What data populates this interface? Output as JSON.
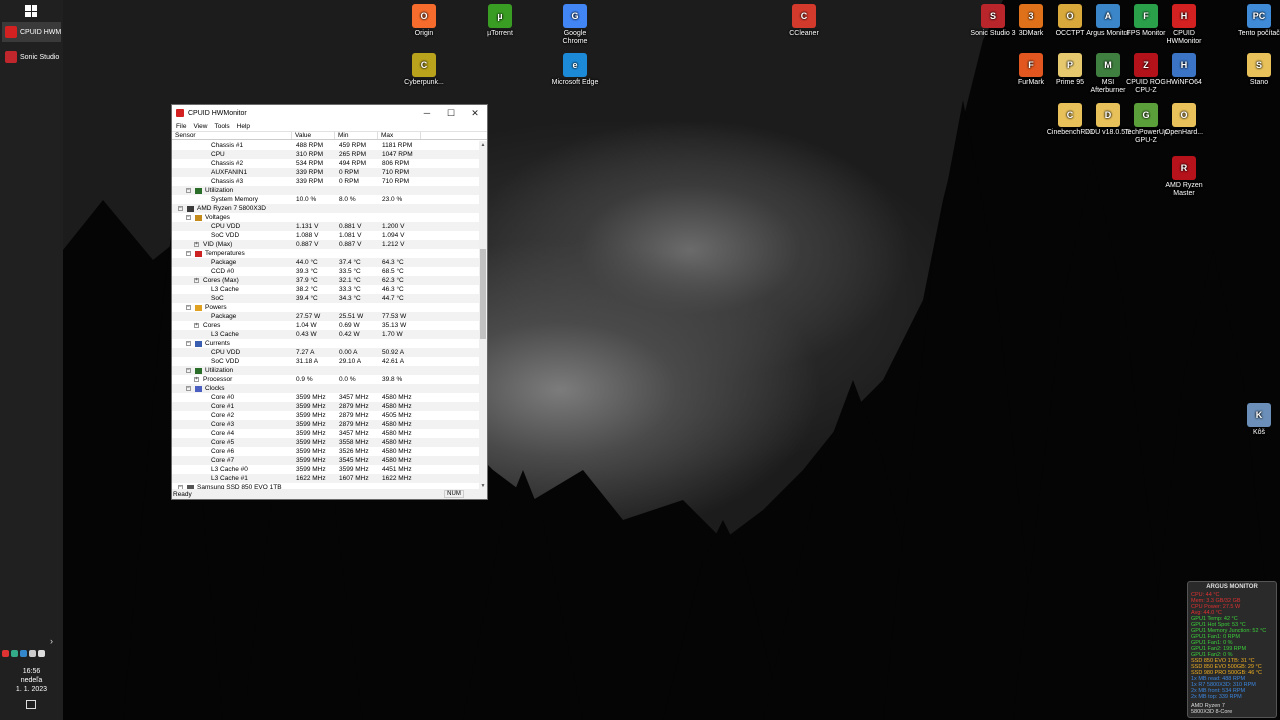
{
  "taskbar": {
    "apps": [
      {
        "label": "CPUID HWM...",
        "active": true,
        "icon": "hwmonitor-icon",
        "color": "#d32020"
      },
      {
        "label": "Sonic Studio 3",
        "active": false,
        "icon": "sonic-studio-icon",
        "color": "#c0272d"
      }
    ],
    "clock": {
      "time": "16:56",
      "day": "nedeľa",
      "date": "1. 1. 2023"
    }
  },
  "desktop_icons": [
    {
      "label": "Origin",
      "color": "#f56c2d",
      "glyph": "O"
    },
    {
      "label": "µTorrent",
      "color": "#3a9d23",
      "glyph": "µ"
    },
    {
      "label": "Google Chrome",
      "color": "#4285f4",
      "glyph": "G"
    },
    {
      "label": "CCleaner",
      "color": "#d33a2c",
      "glyph": "C"
    },
    {
      "label": "Cyberpunk...",
      "color": "#b9a21c",
      "glyph": "C"
    },
    {
      "label": "Microsoft Edge",
      "color": "#1c8ad6",
      "glyph": "e"
    },
    {
      "label": "Sonic Studio 3",
      "color": "#b8262b",
      "glyph": "S"
    },
    {
      "label": "3DMark",
      "color": "#e0711b",
      "glyph": "3"
    },
    {
      "label": "OCCTPT",
      "color": "#d9a93c",
      "glyph": "O"
    },
    {
      "label": "Argus Monitor",
      "color": "#3b86c9",
      "glyph": "A"
    },
    {
      "label": "FPS Monitor",
      "color": "#2aa04a",
      "glyph": "F"
    },
    {
      "label": "CPUID HWMonitor",
      "color": "#d32020",
      "glyph": "H"
    },
    {
      "label": "Tento počítač",
      "color": "#3f8bd8",
      "glyph": "PC"
    },
    {
      "label": "FurMark",
      "color": "#e2571f",
      "glyph": "F"
    },
    {
      "label": "Prime 95",
      "color": "#e6c86e",
      "glyph": "P"
    },
    {
      "label": "MSI Afterburner",
      "color": "#3f7f3f",
      "glyph": "M"
    },
    {
      "label": "CPUID ROG CPU-Z",
      "color": "#b3121b",
      "glyph": "Z"
    },
    {
      "label": "HWiNFO64",
      "color": "#3b74c4",
      "glyph": "H"
    },
    {
      "label": "Stano",
      "color": "#e8c15a",
      "glyph": "S"
    },
    {
      "label": "CinebenchR23",
      "color": "#e8c15a",
      "glyph": "C"
    },
    {
      "label": "DDU v18.0.5.9",
      "color": "#e8c15a",
      "glyph": "D"
    },
    {
      "label": "TechPowerUp GPU-Z",
      "color": "#5b9f3a",
      "glyph": "G"
    },
    {
      "label": "OpenHard...",
      "color": "#e8c15a",
      "glyph": "O"
    },
    {
      "label": "AMD Ryzen Master",
      "color": "#b5121b",
      "glyph": "R"
    },
    {
      "label": "Kôš",
      "color": "#6b8fb8",
      "glyph": "K"
    }
  ],
  "hwmonitor": {
    "title": "CPUID HWMonitor",
    "menu": [
      "File",
      "View",
      "Tools",
      "Help"
    ],
    "columns": [
      "Sensor",
      "Value",
      "Min",
      "Max"
    ],
    "rows": [
      {
        "indent": 4,
        "label": "Chassis #1",
        "value": "488 RPM",
        "min": "459 RPM",
        "max": "1181 RPM"
      },
      {
        "indent": 4,
        "label": "CPU",
        "value": "310 RPM",
        "min": "265 RPM",
        "max": "1047 RPM"
      },
      {
        "indent": 4,
        "label": "Chassis #2",
        "value": "534 RPM",
        "min": "494 RPM",
        "max": "806 RPM"
      },
      {
        "indent": 4,
        "label": "AUXFANIN1",
        "value": "339 RPM",
        "min": "0 RPM",
        "max": "710 RPM"
      },
      {
        "indent": 4,
        "label": "Chassis #3",
        "value": "339 RPM",
        "min": "0 RPM",
        "max": "710 RPM"
      },
      {
        "indent": 2,
        "label": "Utilization",
        "group": true,
        "gicon": "#2a6e2a",
        "value": "",
        "min": "",
        "max": ""
      },
      {
        "indent": 4,
        "label": "System Memory",
        "value": "10.0 %",
        "min": "8.0 %",
        "max": "23.0 %"
      },
      {
        "indent": 1,
        "label": "AMD Ryzen 7 5800X3D",
        "group": true,
        "gicon": "#3b3b3b",
        "value": "",
        "min": "",
        "max": ""
      },
      {
        "indent": 2,
        "label": "Voltages",
        "group": true,
        "gicon": "#c48a1a",
        "value": "",
        "min": "",
        "max": ""
      },
      {
        "indent": 4,
        "label": "CPU VDD",
        "value": "1.131 V",
        "min": "0.881 V",
        "max": "1.200 V"
      },
      {
        "indent": 4,
        "label": "SoC VDD",
        "value": "1.088 V",
        "min": "1.081 V",
        "max": "1.094 V"
      },
      {
        "indent": 3,
        "label": "VID (Max)",
        "expand": true,
        "value": "0.887 V",
        "min": "0.887 V",
        "max": "1.212 V"
      },
      {
        "indent": 2,
        "label": "Temperatures",
        "group": true,
        "gicon": "#cc2222",
        "value": "",
        "min": "",
        "max": ""
      },
      {
        "indent": 4,
        "label": "Package",
        "value": "44.0 °C",
        "min": "37.4 °C",
        "max": "64.3 °C"
      },
      {
        "indent": 4,
        "label": "CCD #0",
        "value": "39.3 °C",
        "min": "33.5 °C",
        "max": "68.5 °C"
      },
      {
        "indent": 3,
        "label": "Cores (Max)",
        "expand": true,
        "value": "37.9 °C",
        "min": "32.1 °C",
        "max": "62.3 °C"
      },
      {
        "indent": 4,
        "label": "L3 Cache",
        "value": "38.2 °C",
        "min": "33.3 °C",
        "max": "46.3 °C"
      },
      {
        "indent": 4,
        "label": "SoC",
        "value": "39.4 °C",
        "min": "34.3 °C",
        "max": "44.7 °C"
      },
      {
        "indent": 2,
        "label": "Powers",
        "group": true,
        "gicon": "#e0a020",
        "value": "",
        "min": "",
        "max": ""
      },
      {
        "indent": 4,
        "label": "Package",
        "value": "27.57 W",
        "min": "25.51 W",
        "max": "77.53 W"
      },
      {
        "indent": 3,
        "label": "Cores",
        "expand": true,
        "value": "1.04 W",
        "min": "0.69 W",
        "max": "35.13 W"
      },
      {
        "indent": 4,
        "label": "L3 Cache",
        "value": "0.43 W",
        "min": "0.42 W",
        "max": "1.70 W"
      },
      {
        "indent": 2,
        "label": "Currents",
        "group": true,
        "gicon": "#3a5fb0",
        "value": "",
        "min": "",
        "max": ""
      },
      {
        "indent": 4,
        "label": "CPU VDD",
        "value": "7.27 A",
        "min": "0.00 A",
        "max": "50.92 A"
      },
      {
        "indent": 4,
        "label": "SoC VDD",
        "value": "31.18 A",
        "min": "29.10 A",
        "max": "42.61 A"
      },
      {
        "indent": 2,
        "label": "Utilization",
        "group": true,
        "gicon": "#2a6e2a",
        "value": "",
        "min": "",
        "max": ""
      },
      {
        "indent": 3,
        "label": "Processor",
        "expand": true,
        "value": "0.9 %",
        "min": "0.0 %",
        "max": "39.8 %"
      },
      {
        "indent": 2,
        "label": "Clocks",
        "group": true,
        "gicon": "#4a5fbf",
        "value": "",
        "min": "",
        "max": ""
      },
      {
        "indent": 4,
        "label": "Core #0",
        "value": "3599 MHz",
        "min": "3457 MHz",
        "max": "4580 MHz"
      },
      {
        "indent": 4,
        "label": "Core #1",
        "value": "3599 MHz",
        "min": "2879 MHz",
        "max": "4580 MHz"
      },
      {
        "indent": 4,
        "label": "Core #2",
        "value": "3599 MHz",
        "min": "2879 MHz",
        "max": "4505 MHz"
      },
      {
        "indent": 4,
        "label": "Core #3",
        "value": "3599 MHz",
        "min": "2879 MHz",
        "max": "4580 MHz"
      },
      {
        "indent": 4,
        "label": "Core #4",
        "value": "3599 MHz",
        "min": "3457 MHz",
        "max": "4580 MHz"
      },
      {
        "indent": 4,
        "label": "Core #5",
        "value": "3599 MHz",
        "min": "3558 MHz",
        "max": "4580 MHz"
      },
      {
        "indent": 4,
        "label": "Core #6",
        "value": "3599 MHz",
        "min": "3526 MHz",
        "max": "4580 MHz"
      },
      {
        "indent": 4,
        "label": "Core #7",
        "value": "3599 MHz",
        "min": "3545 MHz",
        "max": "4580 MHz"
      },
      {
        "indent": 4,
        "label": "L3 Cache #0",
        "value": "3599 MHz",
        "min": "3599 MHz",
        "max": "4451 MHz"
      },
      {
        "indent": 4,
        "label": "L3 Cache #1",
        "value": "1622 MHz",
        "min": "1607 MHz",
        "max": "1622 MHz"
      },
      {
        "indent": 1,
        "label": "Samsung SSD 850 EVO 1TB",
        "group": true,
        "gicon": "#555555",
        "value": "",
        "min": "",
        "max": ""
      }
    ],
    "status": "Ready",
    "status_num": "NUM"
  },
  "argus": {
    "title": "ARGUS MONITOR",
    "lines": [
      {
        "text": "CPU: 44 °C",
        "color": "#e03030"
      },
      {
        "text": "Mem: 3.3 GB/32 GB",
        "color": "#e03030"
      },
      {
        "text": "CPU Power: 27.5 W",
        "color": "#e03030"
      },
      {
        "text": "Avg: 44.0 °C",
        "color": "#e03030"
      },
      {
        "text": "GPU1 Temp: 42 °C",
        "color": "#3ad03a"
      },
      {
        "text": "GPU1 Hot Spot: 53 °C",
        "color": "#3ad03a"
      },
      {
        "text": "GPU1 Memory Junction: 52 °C",
        "color": "#3ad03a"
      },
      {
        "text": "GPU1 Fan1: 0 RPM",
        "color": "#3ad03a"
      },
      {
        "text": "GPU1 Fan1: 0 %",
        "color": "#3ad03a"
      },
      {
        "text": "GPU1 Fan2: 199 RPM",
        "color": "#3ad03a"
      },
      {
        "text": "GPU1 Fan2: 0 %",
        "color": "#3ad03a"
      },
      {
        "text": "SSD 850 EVO 1TB: 31 °C",
        "color": "#f0b020"
      },
      {
        "text": "SSD 850 EVO 500GB: 29 °C",
        "color": "#f0b020"
      },
      {
        "text": "SSD 980 PRO 500GB: 46 °C",
        "color": "#f0b020"
      },
      {
        "text": "1x MB read: 488 RPM",
        "color": "#3b86e0"
      },
      {
        "text": "1x R7 5800X3D: 310 RPM",
        "color": "#3b86e0"
      },
      {
        "text": "2x MB front: 534 RPM",
        "color": "#3b86e0"
      },
      {
        "text": "2x MB top: 339 RPM",
        "color": "#3b86e0"
      }
    ],
    "footer_line1": "AMD Ryzen 7",
    "footer_line2": "5800X3D 8-Core"
  }
}
